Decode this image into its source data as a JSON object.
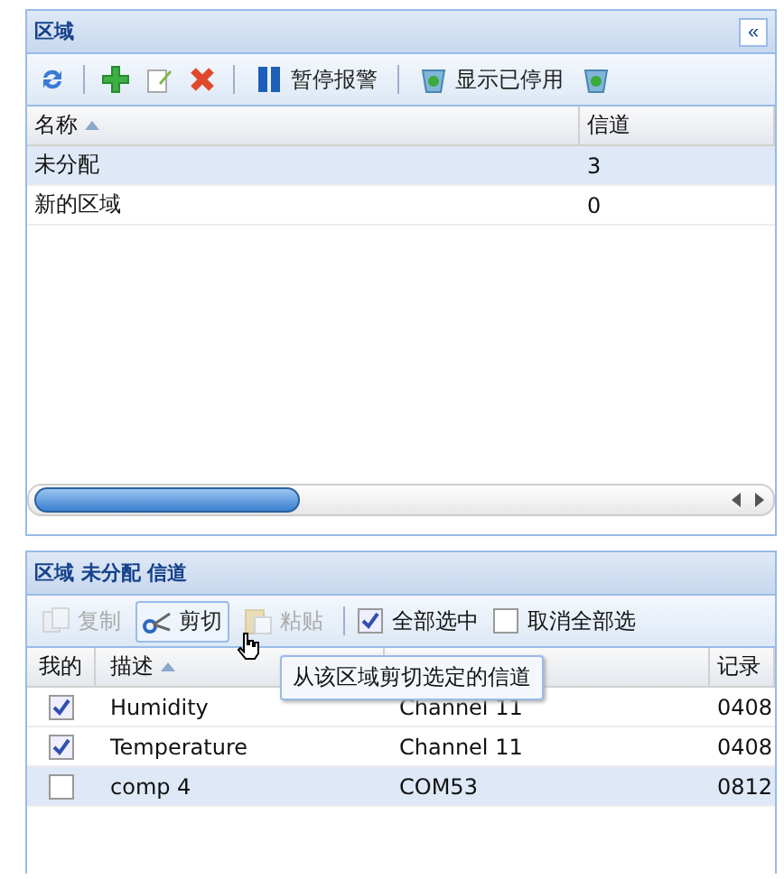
{
  "zones_panel": {
    "title": "区域",
    "collapse_button": "«",
    "toolbar": [
      {
        "kind": "icon"
      },
      {
        "kind": "sep"
      },
      {
        "kind": "icon"
      },
      {
        "kind": "icon"
      },
      {
        "kind": "icon"
      },
      {
        "kind": "sep"
      },
      {
        "kind": "button",
        "label": "暂停报警",
        "disabled": false
      },
      {
        "kind": "sep"
      },
      {
        "kind": "button",
        "label": "显示已停用",
        "disabled": false
      },
      {
        "kind": "icon"
      }
    ],
    "table": {
      "columns": [
        {
          "label": "名称",
          "sorted": true
        },
        {
          "label": "信道",
          "sorted": false
        }
      ],
      "rows": [
        {
          "cells": [
            "未分配",
            "3"
          ],
          "selected": true
        },
        {
          "cells": [
            "新的区域",
            "0"
          ],
          "selected": false
        }
      ]
    }
  },
  "channels_panel": {
    "title": "区域 未分配 信道",
    "toolbar": [
      {
        "kind": "button",
        "label": "复制",
        "disabled": true,
        "hover": false
      },
      {
        "kind": "button",
        "label": "剪切",
        "disabled": false,
        "hover": true
      },
      {
        "kind": "button",
        "label": "粘贴",
        "disabled": true,
        "hover": false
      },
      {
        "kind": "sep"
      },
      {
        "kind": "check",
        "label": "全部选中",
        "checked": true
      },
      {
        "kind": "check",
        "label": "取消全部选",
        "checked": false
      }
    ],
    "tooltip": "从该区域剪切选定的信道",
    "table": {
      "check_column": "我的",
      "columns": [
        {
          "label": "描述",
          "sorted": true
        },
        {},
        {
          "label": "记录",
          "sorted": false
        }
      ],
      "rows": [
        {
          "checked": true,
          "cells": [
            "Humidity",
            "Channel 11",
            "0408"
          ],
          "selected": false
        },
        {
          "checked": true,
          "cells": [
            "Temperature",
            "Channel 11",
            "0408"
          ],
          "selected": false
        },
        {
          "checked": false,
          "cells": [
            "comp 4",
            "COM53",
            "0812"
          ],
          "selected": true
        }
      ]
    }
  }
}
